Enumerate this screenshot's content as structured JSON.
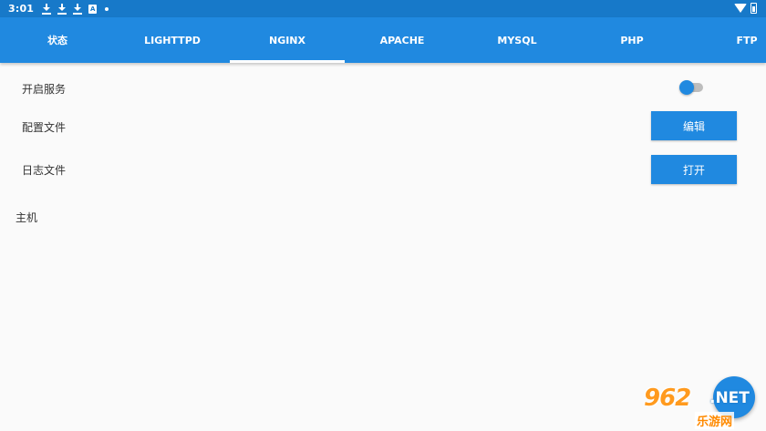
{
  "status_bar": {
    "time": "3:01",
    "notification_icons": [
      "download-icon",
      "download-icon",
      "download-icon",
      "a-icon",
      "dot-icon"
    ],
    "right_icons": [
      "wifi-icon",
      "battery-icon"
    ]
  },
  "tabs": [
    {
      "label": "状态"
    },
    {
      "label": "LIGHTTPD"
    },
    {
      "label": "NGINX"
    },
    {
      "label": "APACHE"
    },
    {
      "label": "MYSQL"
    },
    {
      "label": "PHP"
    },
    {
      "label": "FTP"
    }
  ],
  "selected_tab": "NGINX",
  "settings": {
    "enable_service_label": "开启服务",
    "enable_service_on": true,
    "config_file_label": "配置文件",
    "edit_button": "编辑",
    "log_file_label": "日志文件",
    "open_button": "打开",
    "host_label": "主机"
  },
  "watermark": {
    "number": "962",
    "domain": ".NET",
    "site_name": "乐游网"
  },
  "colors": {
    "status_bar": "#1779c9",
    "primary": "#2089e0",
    "background": "#fafafa"
  }
}
